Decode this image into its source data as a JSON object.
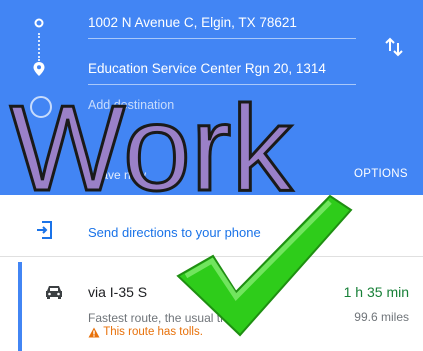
{
  "directions": {
    "origin": "1002 N Avenue C, Elgin, TX 78621",
    "destination": "Education Service Center Rgn 20, 1314",
    "add_destination": "Add destination",
    "leave_now": "Leave now",
    "options": "OPTIONS"
  },
  "send": {
    "label": "Send directions to your phone"
  },
  "route": {
    "via": "via I-35 S",
    "time": "1 h 35 min",
    "description": "Fastest route, the usual traffic",
    "distance": "99.6 miles",
    "tolls": "This route has tolls."
  },
  "overlay": {
    "word": "Work"
  },
  "colors": {
    "header": "#4285f4",
    "link": "#1a73e8",
    "time": "#188038",
    "warning": "#e8710a",
    "word_fill": "#9a80c8",
    "check": "#2ecc1a"
  },
  "icons": [
    "origin-dot-icon",
    "destination-pin-icon",
    "swap-icon",
    "add-destination-icon",
    "send-to-phone-icon",
    "car-icon",
    "warning-icon",
    "checkmark-icon"
  ]
}
